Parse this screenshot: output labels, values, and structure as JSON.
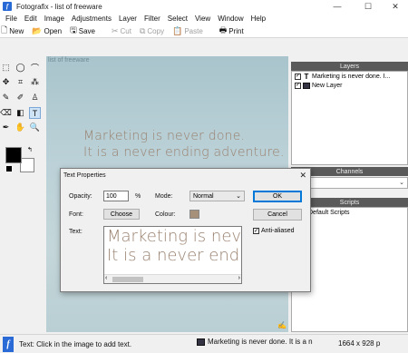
{
  "window": {
    "title": "Fotografix - list of freeware",
    "minimize": "—",
    "maximize": "☐",
    "close": "✕"
  },
  "menu": [
    "File",
    "Edit",
    "Image",
    "Adjustments",
    "Layer",
    "Filter",
    "Select",
    "View",
    "Window",
    "Help"
  ],
  "toolbar": {
    "new": "New",
    "open": "Open",
    "save": "Save",
    "cut": "Cut",
    "copy": "Copy",
    "paste": "Paste",
    "print": "Print"
  },
  "canvas": {
    "label": "list of freeware",
    "line1": "Marketing is never done.",
    "line2": "It is a never ending adventure."
  },
  "panels": {
    "layers": {
      "title": "Layers",
      "items": [
        "Marketing is never done. I...",
        "New Layer"
      ]
    },
    "channels": {
      "title": "Channels"
    },
    "scripts": {
      "title": "Scripts",
      "items": [
        "Default Scripts"
      ]
    }
  },
  "dialog": {
    "title": "Text Properties",
    "opacity_label": "Opacity:",
    "opacity_value": "100",
    "percent": "%",
    "mode_label": "Mode:",
    "mode_value": "Normal",
    "font_label": "Font:",
    "choose_button": "Choose",
    "colour_label": "Colour:",
    "text_label": "Text:",
    "text_line1": "Marketing is nev",
    "text_line2": "It is a never endi",
    "ok_button": "OK",
    "cancel_button": "Cancel",
    "antialiased_label": "Anti-aliased",
    "colour_value": "#a79079"
  },
  "status": {
    "hint": "Text: Click in the image to add text.",
    "layer": "Marketing is never done.  It is a n",
    "size": "1664 x 928 p"
  },
  "colors": {
    "accent": "#2a6ad6",
    "text_colour": "#9a8270",
    "panel_header": "#5a5a5a"
  }
}
